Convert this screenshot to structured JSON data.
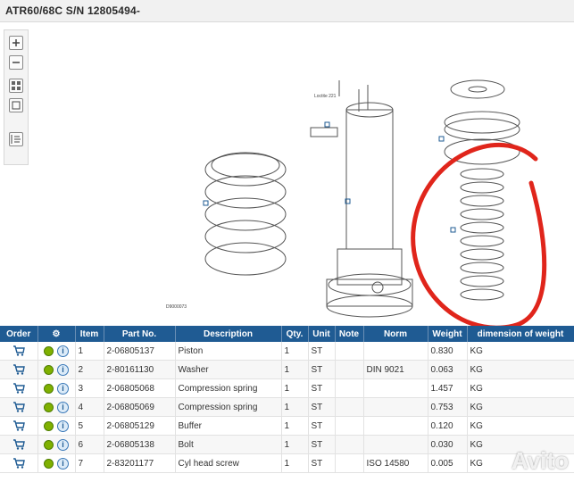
{
  "header": {
    "title": "ATR60/68C S/N 12805494-"
  },
  "toolbar": {
    "icons": [
      "zoom-in-icon",
      "zoom-out-icon",
      "fit-icon",
      "fit-page-icon",
      "export-icon"
    ]
  },
  "drawing": {
    "callout_label": "Loctite 221",
    "drawing_number": "D9000073"
  },
  "table": {
    "headers": [
      "Order",
      "",
      "Item",
      "Part No.",
      "Description",
      "Qty.",
      "Unit",
      "Note",
      "Norm",
      "Weight",
      "dimension of weight"
    ],
    "rows": [
      {
        "item": "1",
        "part_no": "2-06805137",
        "description": "Piston",
        "qty": "1",
        "unit": "ST",
        "note": "",
        "norm": "",
        "weight": "0.830",
        "dim": "KG"
      },
      {
        "item": "2",
        "part_no": "2-80161130",
        "description": "Washer",
        "qty": "1",
        "unit": "ST",
        "note": "",
        "norm": "DIN 9021",
        "weight": "0.063",
        "dim": "KG"
      },
      {
        "item": "3",
        "part_no": "2-06805068",
        "description": "Compression spring",
        "qty": "1",
        "unit": "ST",
        "note": "",
        "norm": "",
        "weight": "1.457",
        "dim": "KG"
      },
      {
        "item": "4",
        "part_no": "2-06805069",
        "description": "Compression spring",
        "qty": "1",
        "unit": "ST",
        "note": "",
        "norm": "",
        "weight": "0.753",
        "dim": "KG"
      },
      {
        "item": "5",
        "part_no": "2-06805129",
        "description": "Buffer",
        "qty": "1",
        "unit": "ST",
        "note": "",
        "norm": "",
        "weight": "0.120",
        "dim": "KG"
      },
      {
        "item": "6",
        "part_no": "2-06805138",
        "description": "Bolt",
        "qty": "1",
        "unit": "ST",
        "note": "",
        "norm": "",
        "weight": "0.030",
        "dim": "KG"
      },
      {
        "item": "7",
        "part_no": "2-83201177",
        "description": "Cyl head screw",
        "qty": "1",
        "unit": "ST",
        "note": "",
        "norm": "ISO 14580",
        "weight": "0.005",
        "dim": "KG"
      }
    ]
  },
  "watermark": "Avito",
  "colors": {
    "header_bg": "#1f5b93",
    "annotation": "#e0251b"
  }
}
